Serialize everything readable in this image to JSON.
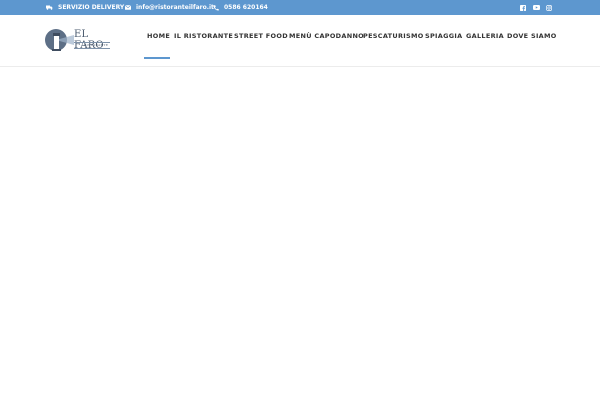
{
  "topbar": {
    "delivery": "SERVIZIO DELIVERY",
    "email": "info@ristoranteilfaro.it",
    "phone": "0586 620164",
    "icons": [
      "truck-icon",
      "envelope-icon",
      "phone-icon",
      "facebook-icon",
      "youtube-icon",
      "instagram-icon"
    ]
  },
  "logo": {
    "title": "EL FARO",
    "subtitle": "RISTORANTE"
  },
  "nav": {
    "items": [
      "HOME",
      "IL RISTORANTE",
      "STREET FOOD",
      "MENÙ CAPODANNO",
      "PESCATURISMO",
      "SPIAGGIA",
      "GALLERIA",
      "DOVE SIAMO"
    ],
    "active": "HOME"
  },
  "colors": {
    "accent": "#5d97cf",
    "text": "#333333",
    "logo": "#4b5b6f"
  }
}
